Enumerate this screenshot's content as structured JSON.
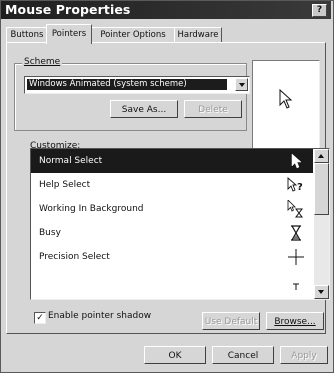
{
  "window": {
    "title": "Mouse Properties",
    "help_label": "?"
  },
  "tabs": [
    {
      "label": "Buttons",
      "active": false
    },
    {
      "label": "Pointers",
      "active": true
    },
    {
      "label": "Pointer Options",
      "active": false
    },
    {
      "label": "Hardware",
      "active": false
    }
  ],
  "scheme": {
    "group_label": "Scheme",
    "selected": "Windows Animated (system scheme)",
    "save_as_label": "Save As...",
    "delete_label": "Delete"
  },
  "preview": {
    "icon": "arrow-help-cursor-icon"
  },
  "customize": {
    "label": "Customize:",
    "items": [
      {
        "label": "Normal Select",
        "icon": "arrow-cursor-icon",
        "selected": true
      },
      {
        "label": "Help Select",
        "icon": "help-cursor-icon",
        "selected": false
      },
      {
        "label": "Working In Background",
        "icon": "working-background-cursor-icon",
        "selected": false
      },
      {
        "label": "Busy",
        "icon": "hourglass-cursor-icon",
        "selected": false
      },
      {
        "label": "Precision Select",
        "icon": "crosshair-cursor-icon",
        "selected": false
      },
      {
        "label": "",
        "icon": "text-select-cursor-icon",
        "selected": false
      }
    ]
  },
  "shadow": {
    "label": "Enable pointer shadow",
    "checked": true,
    "check_mark": "✓"
  },
  "use_default_label": "Use Default",
  "browse_label": "Browse...",
  "buttons": {
    "ok": "OK",
    "cancel": "Cancel",
    "apply": "Apply"
  },
  "colors": {
    "face": "#d6d6d6",
    "selection": "#1a1a1a",
    "title_bar": "#1f1f1f"
  }
}
